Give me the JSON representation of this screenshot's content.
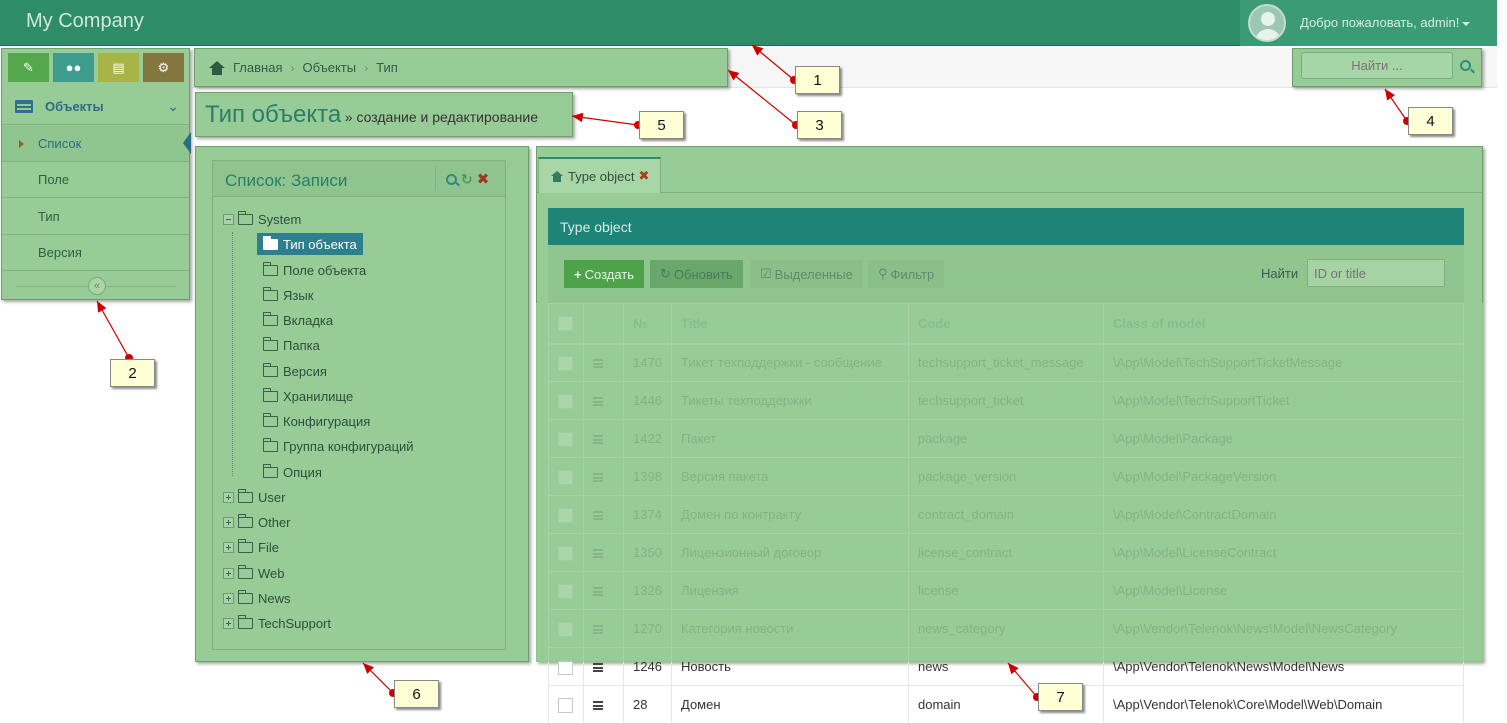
{
  "navbar": {
    "brand": "My Company",
    "welcome": "Добро пожаловать, admin!"
  },
  "sidebar": {
    "buttons": [
      {
        "icon": "pencil-icon",
        "color": "#55a74d"
      },
      {
        "icon": "users-icon",
        "color": "#3d9c8d"
      },
      {
        "icon": "card-icon",
        "color": "#a8b445"
      },
      {
        "icon": "gears-icon",
        "color": "#84763f"
      }
    ],
    "section_label": "Объекты",
    "items": [
      {
        "label": "Список",
        "active": true
      },
      {
        "label": "Поле"
      },
      {
        "label": "Тип"
      },
      {
        "label": "Версия"
      }
    ]
  },
  "breadcrumb": [
    "Главная",
    "Объекты",
    "Тип"
  ],
  "search": {
    "placeholder": "Найти ..."
  },
  "page": {
    "title": "Тип объекта",
    "subtitle": "» создание и редактирование"
  },
  "tree": {
    "title": "Список: Записи",
    "root": "System",
    "children": [
      "Тип объекта",
      "Поле объекта",
      "Язык",
      "Вкладка",
      "Папка",
      "Версия",
      "Хранилище",
      "Конфигурация",
      "Группа конфигураций",
      "Опция"
    ],
    "selected": "Тип объекта",
    "others": [
      "User",
      "Other",
      "File",
      "Web",
      "News",
      "TechSupport"
    ]
  },
  "tab": {
    "label": "Type object"
  },
  "grid": {
    "header": "Type object",
    "buttons": {
      "create": "Создать",
      "refresh": "Обновить",
      "selected": "Выделенные",
      "filter": "Фильтр"
    },
    "search_label": "Найти",
    "search_placeholder": "ID or title",
    "columns": [
      "№",
      "Title",
      "Code",
      "Class of model"
    ],
    "rows": [
      {
        "id": "1470",
        "title": "Тикет техподдержки - сообщение",
        "code": "techsupport_ticket_message",
        "cls": "\\App\\Model\\TechSupportTicketMessage"
      },
      {
        "id": "1446",
        "title": "Тикеты техподдержки",
        "code": "techsupport_ticket",
        "cls": "\\App\\Model\\TechSupportTicket"
      },
      {
        "id": "1422",
        "title": "Пакет",
        "code": "package",
        "cls": "\\App\\Model\\Package"
      },
      {
        "id": "1398",
        "title": "Версия пакета",
        "code": "package_version",
        "cls": "\\App\\Model\\PackageVersion"
      },
      {
        "id": "1374",
        "title": "Домен по контракту",
        "code": "contract_domain",
        "cls": "\\App\\Model\\ContractDomain"
      },
      {
        "id": "1350",
        "title": "Лицензионный договор",
        "code": "license_contract",
        "cls": "\\App\\Model\\LicenseContract"
      },
      {
        "id": "1326",
        "title": "Лицензия",
        "code": "license",
        "cls": "\\App\\Model\\License"
      },
      {
        "id": "1270",
        "title": "Категория новости",
        "code": "news_category",
        "cls": "\\App\\Vendor\\Telenok\\News\\Model\\NewsCategory"
      },
      {
        "id": "1246",
        "title": "Новость",
        "code": "news",
        "cls": "\\App\\Vendor\\Telenok\\News\\Model\\News"
      },
      {
        "id": "28",
        "title": "Домен",
        "code": "domain",
        "cls": "\\App\\Vendor\\Telenok\\Core\\Model\\Web\\Domain"
      }
    ]
  },
  "callouts": [
    "1",
    "2",
    "3",
    "4",
    "5",
    "6",
    "7"
  ],
  "colors": {
    "callout_arrow": "#cc0000",
    "highlight": "#98cc97",
    "navbar": "#2e8c68"
  }
}
